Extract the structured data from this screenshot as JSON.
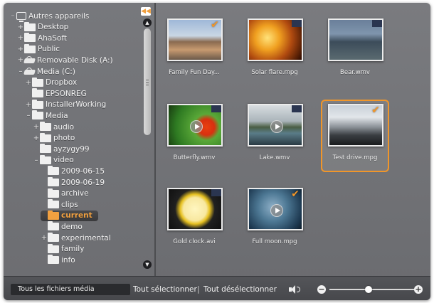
{
  "tree": {
    "items": [
      {
        "label": "Autres appareils",
        "toggle": "–",
        "icon": "computer-icon",
        "indent": 0
      },
      {
        "label": "Desktop",
        "toggle": "+",
        "icon": "folder-icon",
        "indent": 1
      },
      {
        "label": "AhaSoft",
        "toggle": "+",
        "icon": "folder-icon",
        "indent": 1
      },
      {
        "label": "Public",
        "toggle": "+",
        "icon": "folder-icon",
        "indent": 1
      },
      {
        "label": "Removable Disk (A:)",
        "toggle": "+",
        "icon": "disk-icon",
        "indent": 1
      },
      {
        "label": "Media (C:)",
        "toggle": "–",
        "icon": "disk-icon",
        "indent": 1
      },
      {
        "label": "Dropbox",
        "toggle": "+",
        "icon": "folder-icon",
        "indent": 2
      },
      {
        "label": "EPSONREG",
        "toggle": "",
        "icon": "folder-icon",
        "indent": 2
      },
      {
        "label": "InstallerWorking",
        "toggle": "+",
        "icon": "folder-icon",
        "indent": 2
      },
      {
        "label": "Media",
        "toggle": "–",
        "icon": "folder-icon",
        "indent": 2
      },
      {
        "label": "audio",
        "toggle": "+",
        "icon": "folder-icon",
        "indent": 3
      },
      {
        "label": "photo",
        "toggle": "+",
        "icon": "folder-icon",
        "indent": 3
      },
      {
        "label": "ayzygy99",
        "toggle": "",
        "icon": "folder-icon",
        "indent": 3
      },
      {
        "label": "video",
        "toggle": "–",
        "icon": "folder-icon",
        "indent": 3
      },
      {
        "label": "2009-06-15",
        "toggle": "",
        "icon": "folder-icon",
        "indent": 4
      },
      {
        "label": "2009-06-19",
        "toggle": "",
        "icon": "folder-icon",
        "indent": 4
      },
      {
        "label": "archive",
        "toggle": "",
        "icon": "folder-icon",
        "indent": 4
      },
      {
        "label": "clips",
        "toggle": "",
        "icon": "folder-icon",
        "indent": 4
      },
      {
        "label": "current",
        "toggle": "",
        "icon": "folder-icon",
        "indent": 4,
        "selected": true
      },
      {
        "label": "demo",
        "toggle": "",
        "icon": "folder-icon",
        "indent": 4
      },
      {
        "label": "experimental",
        "toggle": "+",
        "icon": "folder-icon",
        "indent": 4
      },
      {
        "label": "family",
        "toggle": "",
        "icon": "folder-icon",
        "indent": 4
      },
      {
        "label": "info",
        "toggle": "",
        "icon": "folder-icon",
        "indent": 4
      }
    ],
    "collapse_glyph": "◀◀",
    "scroll_up_glyph": "▲",
    "scroll_down_glyph": "▼"
  },
  "media": [
    {
      "label": "Family Fun Day...",
      "checked": true,
      "video": false,
      "selected": false
    },
    {
      "label": "Solar flare.mpg",
      "checked": false,
      "video": false,
      "selected": false
    },
    {
      "label": "Bear.wmv",
      "checked": false,
      "video": false,
      "selected": false
    },
    {
      "label": "Butterfly.wmv",
      "checked": false,
      "video": true,
      "selected": false
    },
    {
      "label": "Lake.wmv",
      "checked": false,
      "video": true,
      "selected": false
    },
    {
      "label": "Test drive.mpg",
      "checked": true,
      "video": false,
      "selected": true
    },
    {
      "label": "Gold clock.avi",
      "checked": false,
      "video": false,
      "selected": false
    },
    {
      "label": "Full moon.mpg",
      "checked": true,
      "video": true,
      "selected": false
    }
  ],
  "toolbar": {
    "filter_label": "Tous les fichiers média",
    "select_all": "Tout sélectionner",
    "separator": "|",
    "deselect_all": "Tout désélectionner",
    "zoom_out": "−",
    "zoom_in": "+",
    "zoom_level": 0.45
  },
  "colors": {
    "accent": "#f0962a"
  }
}
